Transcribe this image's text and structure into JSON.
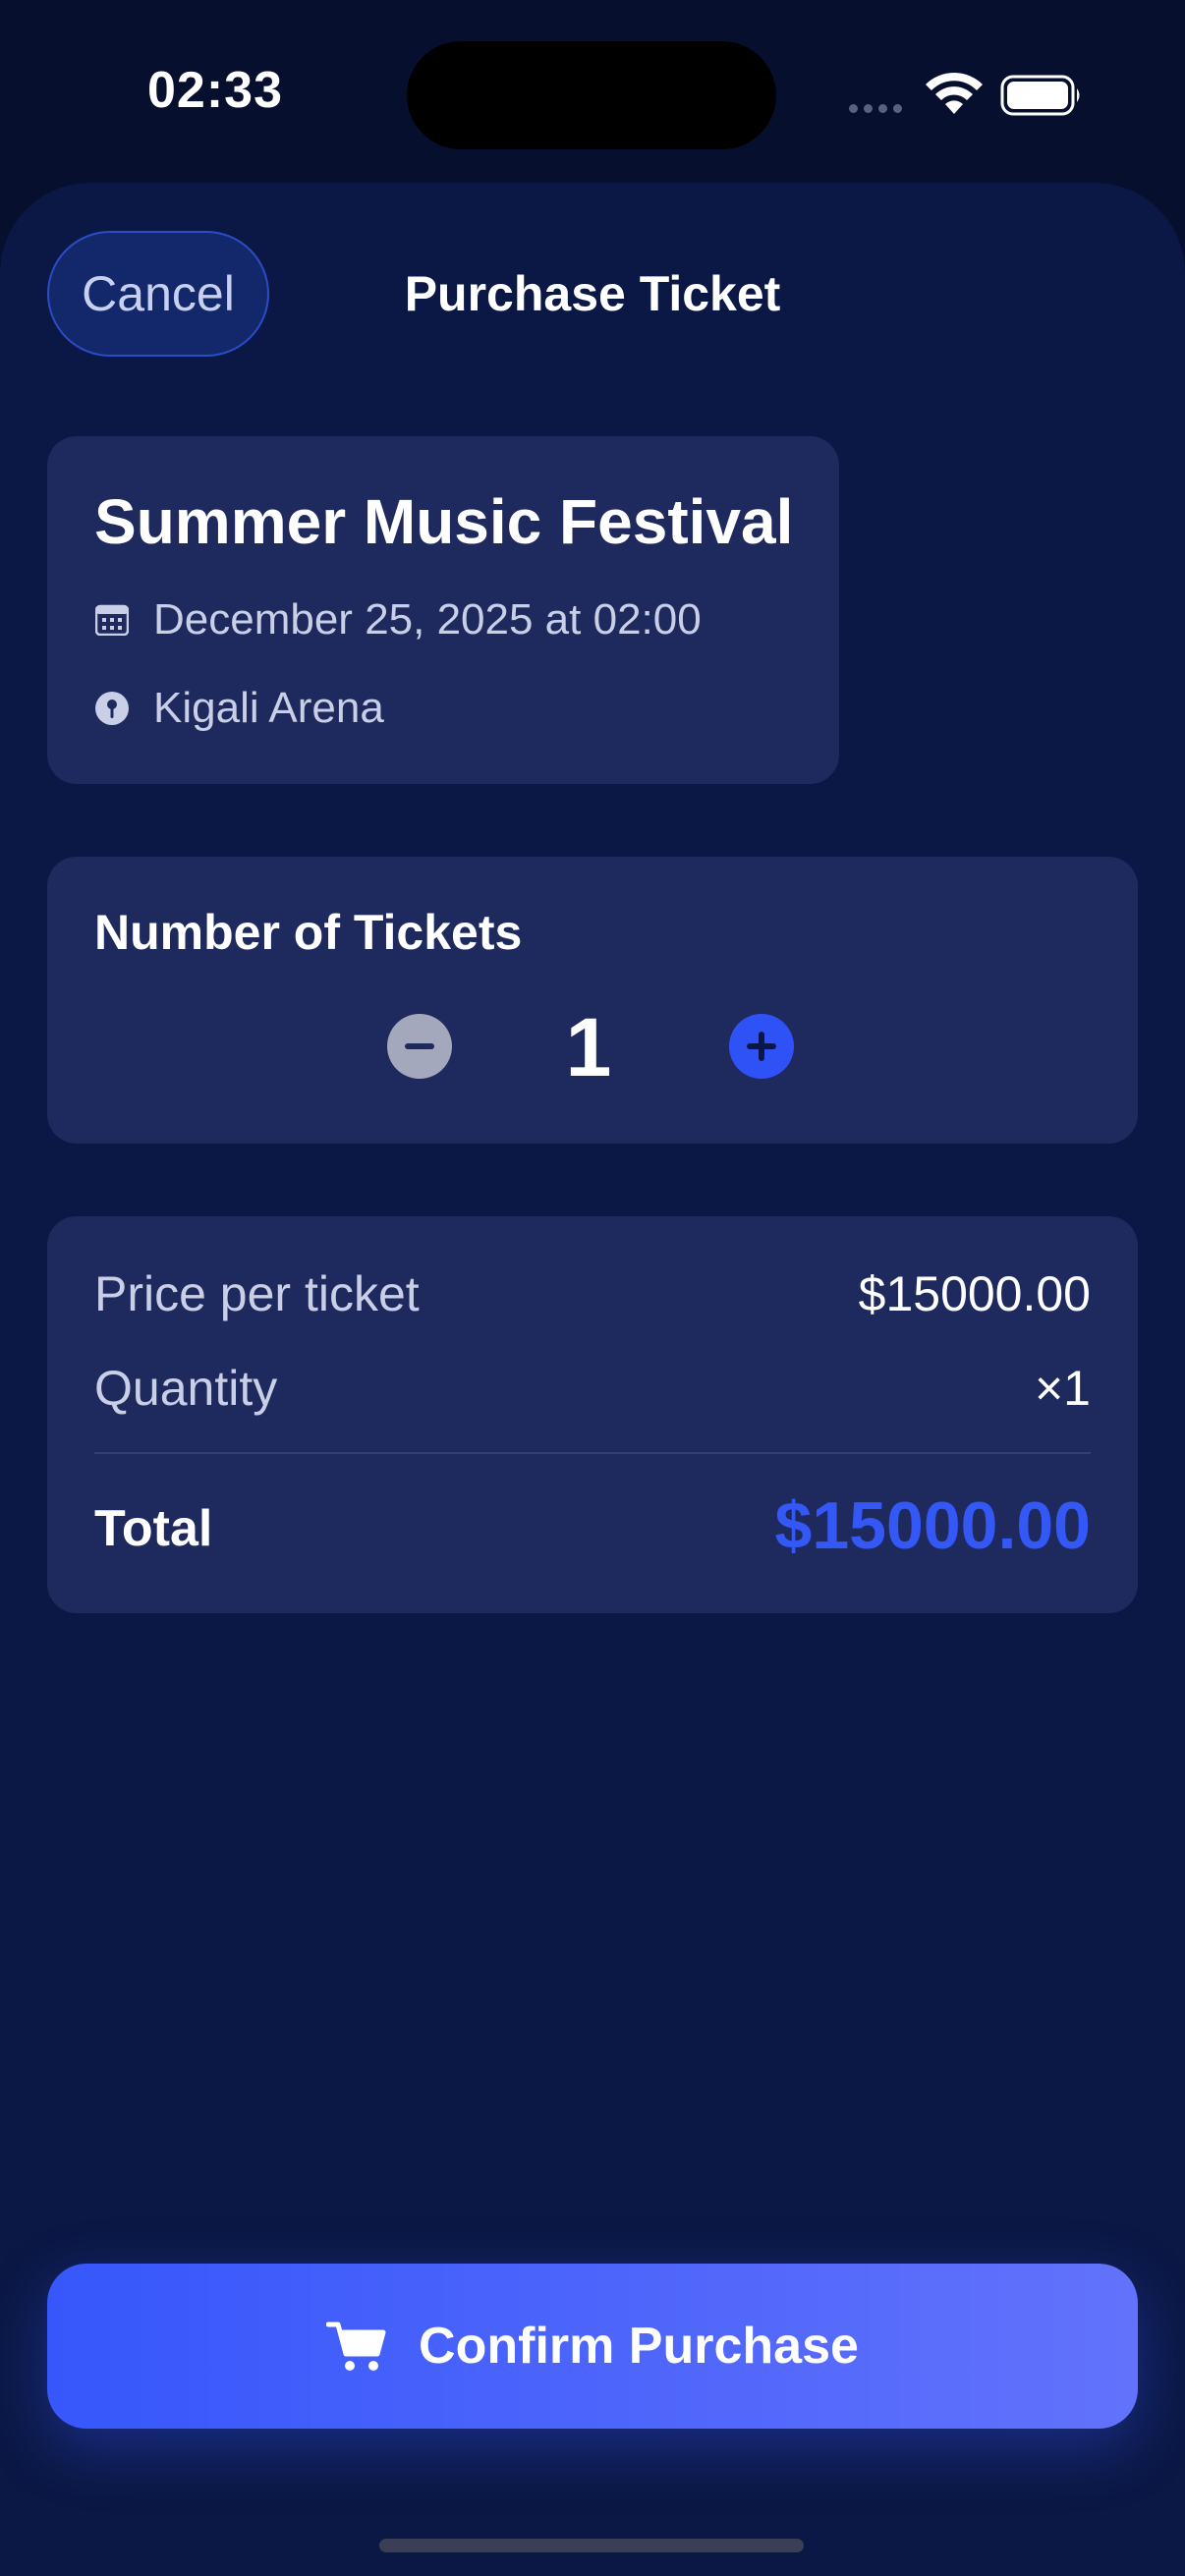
{
  "status_bar": {
    "time": "02:33"
  },
  "nav": {
    "cancel_label": "Cancel",
    "title": "Purchase Ticket"
  },
  "event": {
    "title": "Summer Music Festival",
    "datetime": "December 25, 2025 at 02:00",
    "venue": "Kigali Arena"
  },
  "tickets": {
    "label": "Number of Tickets",
    "count": "1"
  },
  "summary": {
    "price_label": "Price per ticket",
    "price_value": "$15000.00",
    "quantity_label": "Quantity",
    "quantity_value": "×1",
    "total_label": "Total",
    "total_value": "$15000.00"
  },
  "confirm": {
    "label": "Confirm Purchase"
  },
  "icons": {
    "calendar": "calendar-icon",
    "location": "location-icon",
    "minus": "minus-circle-icon",
    "plus": "plus-circle-icon",
    "cart": "cart-icon",
    "wifi": "wifi-icon",
    "battery": "battery-icon"
  },
  "colors": {
    "background": "#070f2f",
    "sheet": "#0b1845",
    "card": "#1e2a5e",
    "accent": "#3358f5",
    "button_gradient_start": "#3757fb",
    "button_gradient_end": "#6272fb"
  }
}
